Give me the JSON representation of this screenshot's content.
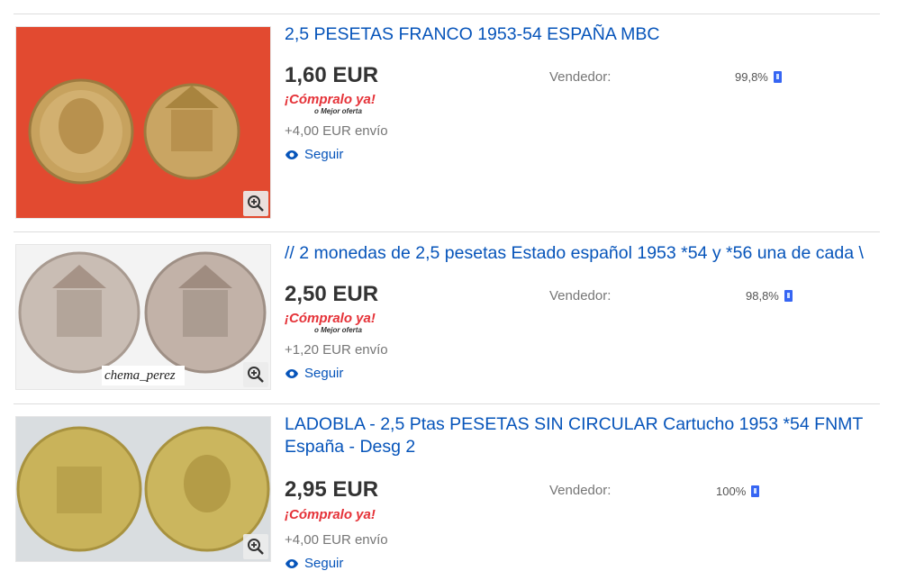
{
  "labels": {
    "seller": "Vendedor:",
    "follow": "Seguir",
    "buy_now_main": "¡Cómpralo ya!",
    "buy_now_sub": "o Mejor oferta"
  },
  "colors": {
    "link": "#0654ba",
    "price": "#333333",
    "muted": "#767676",
    "buy_now_red": "#e53238",
    "badge_blue": "#3665f3"
  },
  "listings": [
    {
      "title": "2,5 PESETAS FRANCO 1953-54 ESPAÑA MBC",
      "price": "1,60 EUR",
      "shipping": "+4,00 EUR envío",
      "feedback": "99,8%",
      "image": {
        "background": "#e24a30",
        "watermark": ""
      }
    },
    {
      "title": "// 2 monedas de 2,5 pesetas Estado español 1953 *54 y *56 una de cada \\",
      "price": "2,50 EUR",
      "shipping": "+1,20 EUR envío",
      "feedback": "98,8%",
      "image": {
        "background": "#f3f3f3",
        "watermark": "chema_perez"
      }
    },
    {
      "title": "LADOBLA - 2,5 Ptas PESETAS SIN CIRCULAR Cartucho 1953 *54 FNMT España - Desg 2",
      "price": "2,95 EUR",
      "shipping": "+4,00 EUR envío",
      "feedback": "100%",
      "image": {
        "background": "#d9dde0",
        "watermark": ""
      }
    }
  ]
}
